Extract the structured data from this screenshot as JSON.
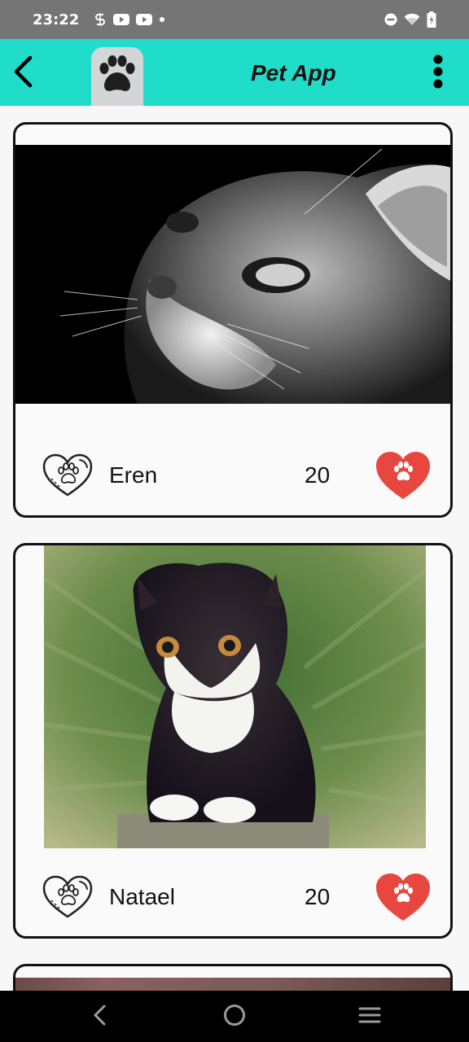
{
  "status_bar": {
    "time": "23:22",
    "left_icons": [
      "sync-icon",
      "youtube-icon",
      "youtube-icon",
      "dot-icon"
    ],
    "right_icons": [
      "do-not-disturb-icon",
      "wifi-icon",
      "battery-charging-icon"
    ]
  },
  "app_bar": {
    "title": "Pet App",
    "background": "#1fddc9",
    "back_icon": "chevron-left-icon",
    "logo_icon": "paw-icon",
    "menu_icon": "more-vert-icon"
  },
  "pets": [
    {
      "name": "Eren",
      "likes": "20",
      "photo": "black-and-white-cat"
    },
    {
      "name": "Natael",
      "likes": "20",
      "photo": "black-white-persian-kitten"
    },
    {
      "name": "",
      "likes": "",
      "photo": "cat-partial"
    }
  ],
  "colors": {
    "like_red": "#e8473f",
    "card_border": "#111111"
  },
  "nav_bar": {
    "icons": [
      "back-icon",
      "home-icon",
      "recents-icon"
    ]
  }
}
